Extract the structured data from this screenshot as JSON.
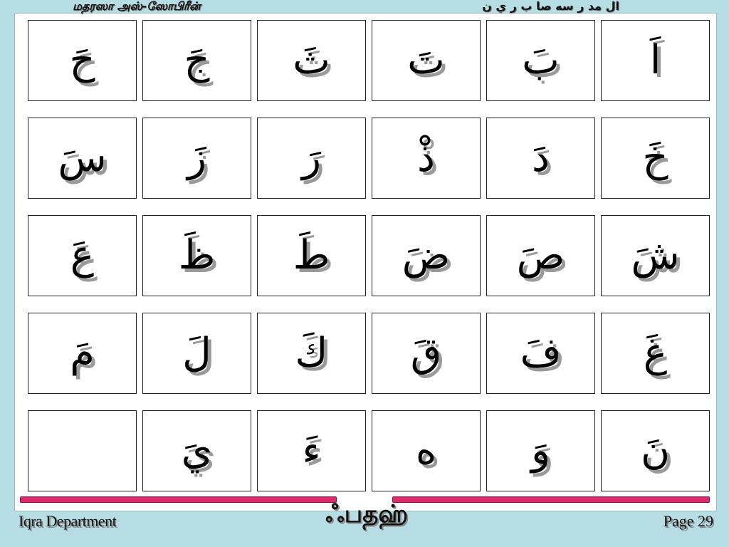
{
  "header": {
    "left_title": "மதரஸா அஸ்-ஸோபிரீன்",
    "right_title": "ال مد ر سه صا ب ر ي ن"
  },
  "cards": [
    {
      "letter": "اَ"
    },
    {
      "letter": "بَ"
    },
    {
      "letter": "تَ"
    },
    {
      "letter": "ثَ"
    },
    {
      "letter": "جَ"
    },
    {
      "letter": "حَ"
    },
    {
      "letter": "خَ"
    },
    {
      "letter": "دَ"
    },
    {
      "letter": "ذْ"
    },
    {
      "letter": "رَ"
    },
    {
      "letter": "زَ"
    },
    {
      "letter": "سَ"
    },
    {
      "letter": "شَ"
    },
    {
      "letter": "صَ"
    },
    {
      "letter": "ضَ"
    },
    {
      "letter": "طَ"
    },
    {
      "letter": "ظَ"
    },
    {
      "letter": "عَ"
    },
    {
      "letter": "غَ"
    },
    {
      "letter": "فَ"
    },
    {
      "letter": "قَ"
    },
    {
      "letter": "كَ"
    },
    {
      "letter": "لَ"
    },
    {
      "letter": "مَ"
    },
    {
      "letter": "نَ"
    },
    {
      "letter": "وَ"
    },
    {
      "letter": "ه"
    },
    {
      "letter": "ءَ"
    },
    {
      "letter": "يَ"
    },
    {
      "letter": ""
    }
  ],
  "footer": {
    "department": "Iqra Department",
    "center_label": "ஃபதஹ்",
    "page": "Page 29"
  },
  "colors": {
    "frame": "#b7dde4",
    "bar": "#dc2a6c"
  }
}
